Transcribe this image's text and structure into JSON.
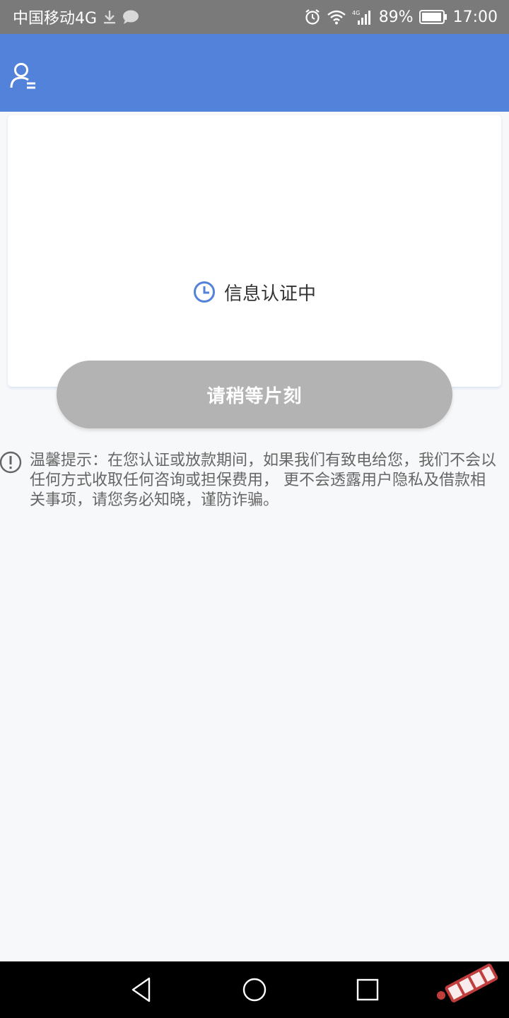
{
  "status_bar": {
    "carrier": "中国移动4G",
    "battery": "89%",
    "time": "17:00",
    "icons": [
      "download-icon",
      "chat-bubble-icon",
      "alarm-icon",
      "wifi-icon",
      "signal-icon",
      "battery-icon"
    ]
  },
  "app_bar": {
    "color": "#5282d9",
    "icon": "user-menu-icon"
  },
  "card": {
    "status_text": "信息认证中",
    "status_icon": "clock-icon",
    "accent_color": "#5282d9"
  },
  "wait_button": {
    "label": "请稍等片刻",
    "color": "#b3b3b3"
  },
  "tip": {
    "icon": "exclamation-circle-icon",
    "text": "温馨提示：在您认证或放款期间，如果我们有致电给您，我们不会以任何方式收取任何咨询或担保费用， 更不会透露用户隐私及借款相关事项，请您务必知晓，谨防诈骗。"
  },
  "nav_bar": {
    "icons": [
      "back-triangle-icon",
      "home-circle-icon",
      "recent-square-icon"
    ]
  }
}
